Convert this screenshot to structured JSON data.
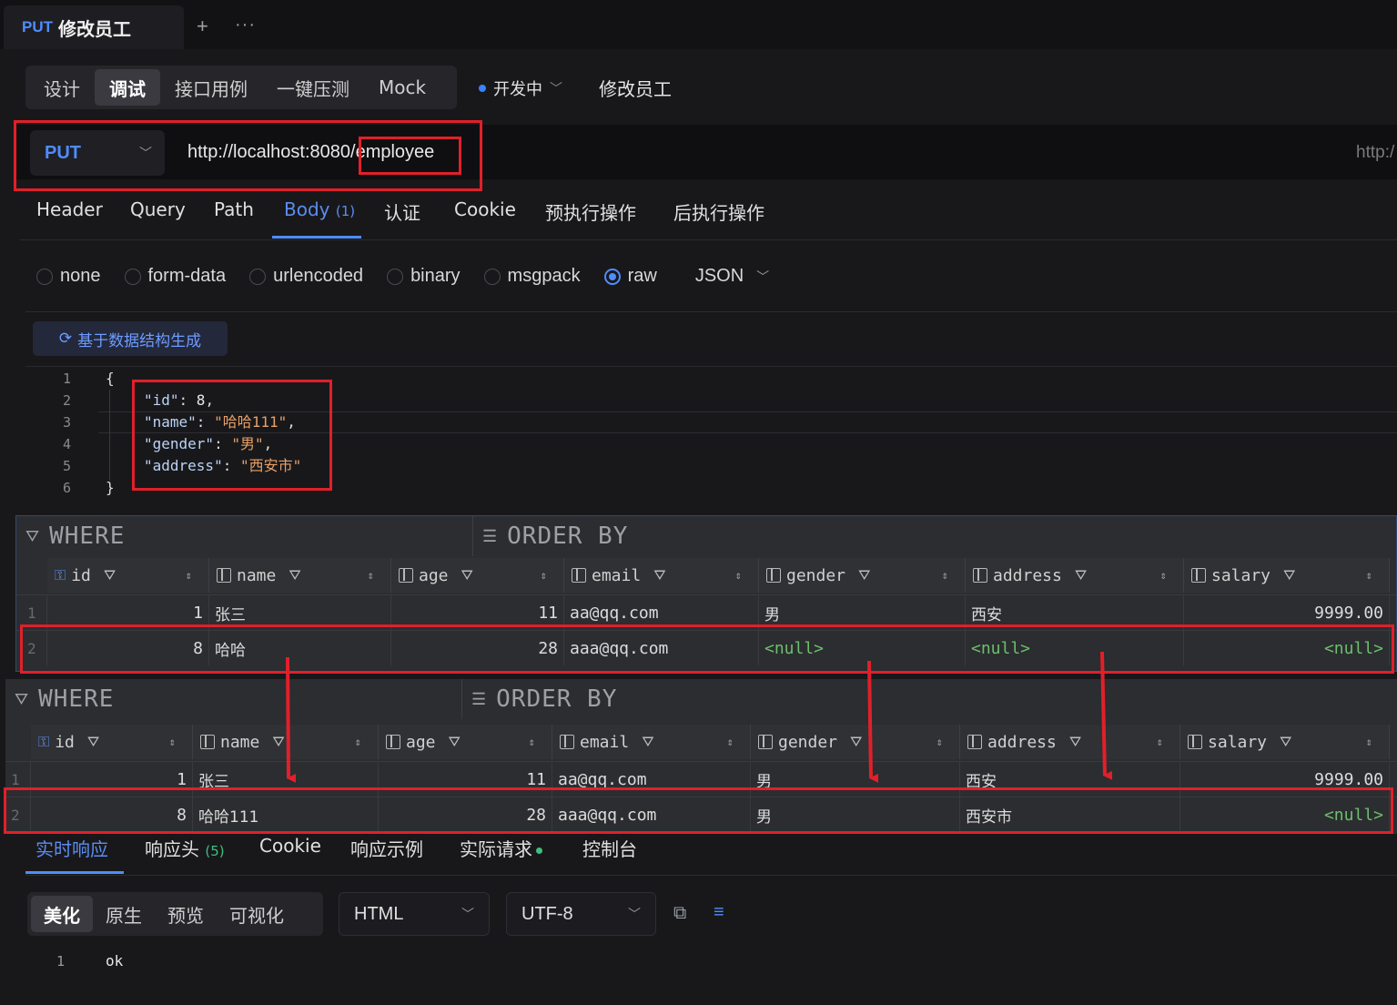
{
  "tab": {
    "method": "PUT",
    "title": "修改员工",
    "plus": "+",
    "more": "···"
  },
  "modes": [
    "设计",
    "调试",
    "接口用例",
    "一键压测",
    "Mock"
  ],
  "status": "开发中",
  "api_name": "修改员工",
  "request": {
    "method": "PUT",
    "url": "http://localhost:8080/employee",
    "url_right": "http:/"
  },
  "req_tabs": {
    "header": "Header",
    "query": "Query",
    "path": "Path",
    "body": "Body",
    "body_count": "(1)",
    "auth": "认证",
    "cookie": "Cookie",
    "pre": "预执行操作",
    "post": "后执行操作"
  },
  "body_types": {
    "none": "none",
    "form_data": "form-data",
    "urlencoded": "urlencoded",
    "binary": "binary",
    "msgpack": "msgpack",
    "raw": "raw",
    "format": "JSON"
  },
  "generate_btn": "基于数据结构生成",
  "code": {
    "lines": [
      "1",
      "2",
      "3",
      "4",
      "5",
      "6"
    ],
    "open": "{",
    "close": "}",
    "id_key": "\"id\"",
    "id_val": "8",
    "name_key": "\"name\"",
    "name_val": "\"哈哈111\"",
    "gender_key": "\"gender\"",
    "gender_val": "\"男\"",
    "address_key": "\"address\"",
    "address_val": "\"西安市\""
  },
  "db": {
    "where": "WHERE",
    "order_by": "ORDER BY",
    "columns": [
      "id",
      "name",
      "age",
      "email",
      "gender",
      "address",
      "salary"
    ],
    "before": [
      {
        "n": "1",
        "id": "1",
        "name": "张三",
        "age": "11",
        "email": "aa@qq.com",
        "gender": "男",
        "address": "西安",
        "salary": "9999.00"
      },
      {
        "n": "2",
        "id": "8",
        "name": "哈哈",
        "age": "28",
        "email": "aaa@qq.com",
        "gender": "<null>",
        "address": "<null>",
        "salary": "<null>"
      }
    ],
    "after": [
      {
        "n": "1",
        "id": "1",
        "name": "张三",
        "age": "11",
        "email": "aa@qq.com",
        "gender": "男",
        "address": "西安",
        "salary": "9999.00"
      },
      {
        "n": "2",
        "id": "8",
        "name": "哈哈111",
        "age": "28",
        "email": "aaa@qq.com",
        "gender": "男",
        "address": "西安市",
        "salary": "<null>"
      }
    ]
  },
  "resp_tabs": {
    "live": "实时响应",
    "headers": "响应头",
    "headers_count": "(5)",
    "cookie": "Cookie",
    "example": "响应示例",
    "actual": "实际请求",
    "console": "控制台"
  },
  "views": [
    "美化",
    "原生",
    "预览",
    "可视化"
  ],
  "resp_format": "HTML",
  "resp_encoding": "UTF-8",
  "response": {
    "line": "1",
    "text": "ok"
  },
  "colors": {
    "accent": "#4f8cff",
    "annotation": "#e0202a",
    "null": "#6cbf6c"
  }
}
